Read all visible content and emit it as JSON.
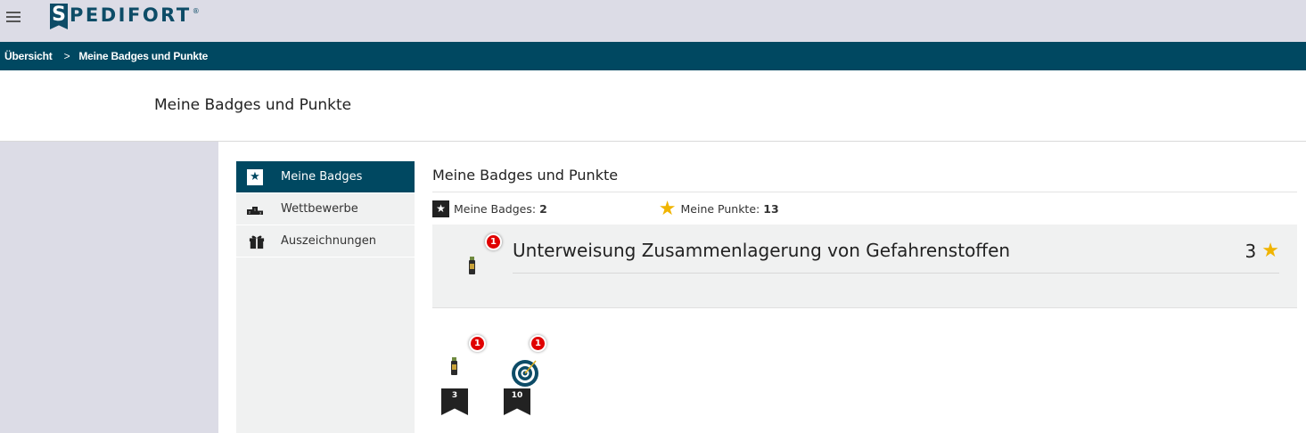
{
  "brand": {
    "logo_letter": "S",
    "logo_rest": "PEDIFORT",
    "logo_mark": "®",
    "color": "#0d4c67"
  },
  "breadcrumb": {
    "home": "Übersicht",
    "separator": ">",
    "current": "Meine Badges und Punkte"
  },
  "page": {
    "title": "Meine Badges und Punkte"
  },
  "sidebar": {
    "items": [
      {
        "label": "Meine Badges",
        "icon": "star-icon",
        "active": true
      },
      {
        "label": "Wettbewerbe",
        "icon": "podium-icon",
        "active": false
      },
      {
        "label": "Auszeichnungen",
        "icon": "gift-icon",
        "active": false
      }
    ]
  },
  "content": {
    "title": "Meine Badges und Punkte",
    "badges_label": "Meine Badges:",
    "badges_count": "2",
    "points_label": "Meine Punkte:",
    "points_count": "13",
    "course": {
      "title": "Unterweisung Zusammenlagerung von Gefahrenstoffen",
      "points": "3",
      "notification": "1",
      "icon": "bottle-icon"
    },
    "badge_tiles": [
      {
        "icon": "bottle-icon",
        "notification": "1",
        "value": "3"
      },
      {
        "icon": "target-icon",
        "notification": "1",
        "value": "10"
      }
    ]
  },
  "colors": {
    "primary": "#004861",
    "accent_star": "#f0b400",
    "notification": "#e00000",
    "sidebar_bg": "#f0f1f1",
    "page_bg": "#dcdce6"
  }
}
